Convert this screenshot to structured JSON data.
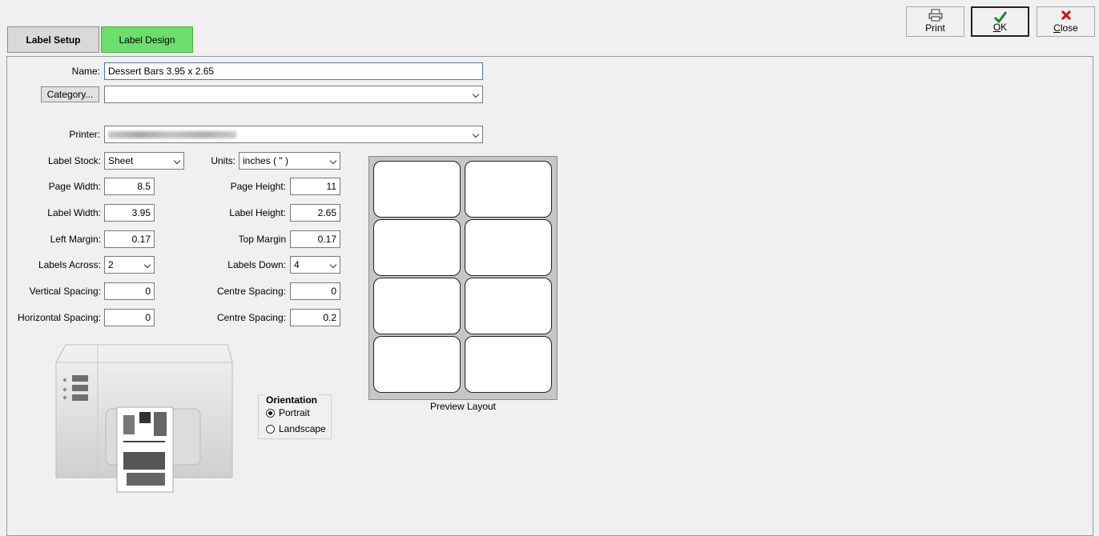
{
  "tabs": {
    "label_setup": "Label Setup",
    "label_design": "Label Design"
  },
  "toolbar": {
    "print": "Print",
    "ok_accel": "O",
    "ok_rest": "K",
    "close_accel": "C",
    "close_rest": "lose"
  },
  "form": {
    "name_label": "Name:",
    "name_value": "Dessert Bars 3.95 x 2.65",
    "category_button": "Category...",
    "category_value": "",
    "printer_label": "Printer:",
    "label_stock_label": "Label Stock:",
    "label_stock_value": "Sheet",
    "units_label": "Units:",
    "units_value": "inches ( \" )",
    "page_width_label": "Page Width:",
    "page_width": "8.5",
    "page_height_label": "Page Height:",
    "page_height": "11",
    "label_width_label": "Label Width:",
    "label_width": "3.95",
    "label_height_label": "Label Height:",
    "label_height": "2.65",
    "left_margin_label": "Left Margin:",
    "left_margin": "0.17",
    "top_margin_label": "Top Margin",
    "top_margin": "0.17",
    "labels_across_label": "Labels Across:",
    "labels_across": "2",
    "labels_down_label": "Labels Down:",
    "labels_down": "4",
    "vertical_spacing_label": "Vertical Spacing:",
    "vertical_spacing": "0",
    "centre_spacing_v_label": "Centre Spacing:",
    "centre_spacing_v": "0",
    "horizontal_spacing_label": "Horizontal Spacing:",
    "horizontal_spacing": "0",
    "centre_spacing_h_label": "Centre Spacing:",
    "centre_spacing_h": "0.2"
  },
  "orientation": {
    "title": "Orientation",
    "portrait": "Portrait",
    "landscape": "Landscape",
    "selected": "Portrait"
  },
  "preview": {
    "caption": "Preview Layout"
  },
  "colors": {
    "active_tab": "#6bde6b",
    "ok_check": "#1a8a1a",
    "close_x": "#cc1111"
  }
}
